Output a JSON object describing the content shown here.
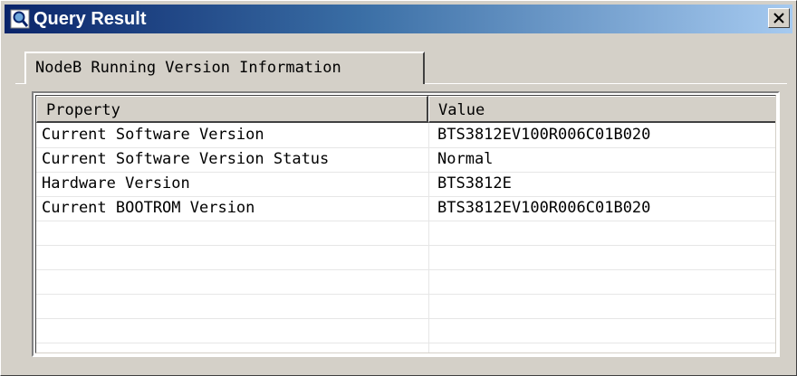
{
  "window": {
    "title": "Query Result",
    "close_label": "✕"
  },
  "tab": {
    "label": "NodeB Running Version Information"
  },
  "table": {
    "columns": [
      "Property",
      "Value"
    ],
    "rows": [
      {
        "property": "Current Software Version",
        "value": "BTS3812EV100R006C01B020"
      },
      {
        "property": "Current Software Version Status",
        "value": "Normal"
      },
      {
        "property": "Hardware Version",
        "value": "BTS3812E"
      },
      {
        "property": "Current BOOTROM Version",
        "value": "BTS3812EV100R006C01B020"
      }
    ]
  },
  "icons": {
    "title_icon": "magnifier-window-icon",
    "close_icon": "close-icon"
  },
  "colors": {
    "title_start": "#0a246a",
    "title_end": "#a6caf0",
    "face": "#d4d0c8"
  }
}
